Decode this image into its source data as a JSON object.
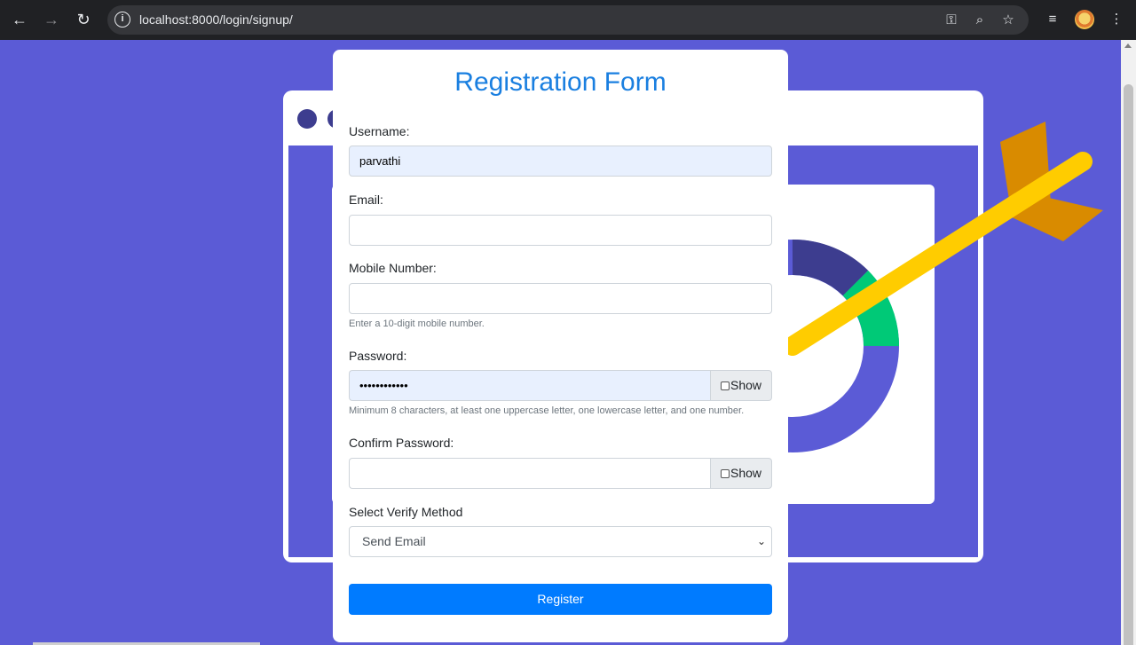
{
  "browser": {
    "url": "localhost:8000/login/signup/",
    "back_icon": "←",
    "forward_icon": "→",
    "reload_icon": "↻",
    "info_icon": "i",
    "key_icon": "⚿",
    "zoom_icon": "⌕",
    "star_icon": "☆",
    "playlist_icon": "≡",
    "menu_icon": "⋮"
  },
  "form": {
    "title": "Registration Form",
    "username_label": "Username:",
    "username_value": "parvathi",
    "email_label": "Email:",
    "email_value": "",
    "mobile_label": "Mobile Number:",
    "mobile_value": "",
    "mobile_help": "Enter a 10-digit mobile number.",
    "password_label": "Password:",
    "password_value": "••••••••••••",
    "password_show": "Show",
    "password_help": "Minimum 8 characters, at least one uppercase letter, one lowercase letter, and one number.",
    "confirm_label": "Confirm Password:",
    "confirm_value": "",
    "confirm_show": "Show",
    "verify_label": "Select Verify Method",
    "verify_selected": "Send Email",
    "verify_chevron": "⌄",
    "register_label": "Register"
  },
  "colors": {
    "page_background": "#5b5bd6",
    "title_blue": "#1a7fe0",
    "button_blue": "#007bff",
    "autofill_background": "#e8f0fe"
  }
}
